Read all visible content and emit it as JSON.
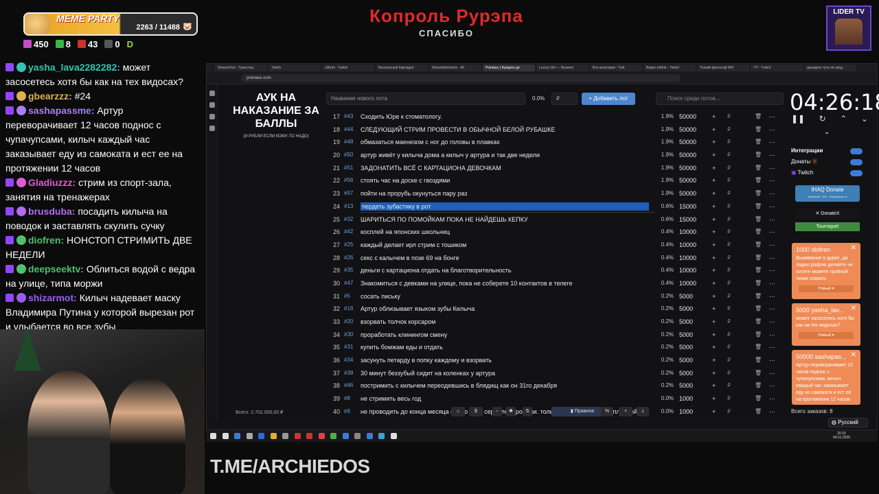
{
  "overlay": {
    "alert_title": "Копроль Рурэпа",
    "alert_sub": "СПАСИБО",
    "meme_party_label": "MEME PARTY",
    "meme_progress": "2263 / 11488",
    "stats": {
      "points": "450",
      "k": "8",
      "ua": "43",
      "w": "0"
    },
    "lider_label": "LIDER TV",
    "tme": "T.ME/ARCHIEDOS"
  },
  "chat": [
    {
      "user": "yasha_lava2282282:",
      "text": "может засосетесь хотя бы как на тех видосах?",
      "color": "#34c3b0"
    },
    {
      "user": "gbearzzz:",
      "text": "#24",
      "color": "#e0b050"
    },
    {
      "user": "sashapassme:",
      "text": "Артур переворачивает 12 часов поднос с чупачупсами, килыч каждый час заказывает еду из самоката и ест ее на протяжении 12 часов",
      "color": "#a77ff0"
    },
    {
      "user": "Gladiuzzz:",
      "text": "стрим из спорт-зала, занятия на тренажерах",
      "color": "#e05bd6"
    },
    {
      "user": "brusduba:",
      "text": "посадить килыча на поводок и заставлять скулить сучку",
      "color": "#b26cf0"
    },
    {
      "user": "diofren:",
      "text": "НОНСТОП СТРИМИТЬ ДВЕ НЕДЕЛИ",
      "color": "#4ec06b"
    },
    {
      "user": "deepseektv:",
      "text": "Облиться водой с ведра на улице, типа моржи",
      "color": "#4ec06b"
    },
    {
      "user": "shizarmot:",
      "text": "Килыч надевает маску Владимира Путина у которой вырезан рот и улыбается во все зубы",
      "color": "#9a5cf0"
    }
  ],
  "browser": {
    "tabs": [
      "StreamVivo - Трансляц",
      "Twitch",
      "s3briel - Twitch",
      "Бесплатный Картадон",
      "StreamElements - 40",
      "Pointauc | Аукцион до",
      "Luxury Girl — Buseeni",
      "Все категории - Twit",
      "Видео toMuk - Twitch",
      "Тонкий философ WH",
      "!!!? - Twitch",
      "аркадиос чуть не увод"
    ],
    "url": "pointauc.com"
  },
  "app": {
    "title": "АУК НА НАКАЗАНИЕ ЗА БАЛЛЫ",
    "subtitle": "(И РУБЛИ ЕСЛИ КОМУ-ТО НАДО)",
    "lot_placeholder": "Название нового лота",
    "lot_pct": "0.0%",
    "lot_currency": "₽",
    "add_button": "Добавить лот",
    "search_placeholder": "Поиск среди лотов...",
    "rows": [
      {
        "n": "17",
        "id": "43",
        "text": "Сходить Юре к стоматологу.",
        "pct": "1.9%",
        "amount": "50000"
      },
      {
        "n": "18",
        "id": "44",
        "text": "СЛЕДУЮЩИЙ СТРИМ ПРОВЕСТИ В ОБЫЧНОЙ БЕЛОЙ РУБАШКЕ",
        "pct": "1.9%",
        "amount": "50000"
      },
      {
        "n": "19",
        "id": "48",
        "text": "обмазаться маенезом с ног до головы в плавках",
        "pct": "1.9%",
        "amount": "50000"
      },
      {
        "n": "20",
        "id": "50",
        "text": "артур живёт у килыча дома а килыч у артура и так две недели",
        "pct": "1.9%",
        "amount": "50000"
      },
      {
        "n": "21",
        "id": "51",
        "text": "ЗАДОНАТИТЬ ВСЁ С КАРТАЦИОНА ДЕВОЧКАМ",
        "pct": "1.9%",
        "amount": "50000"
      },
      {
        "n": "22",
        "id": "56",
        "text": "стоять час на доске с гвоздями",
        "pct": "1.9%",
        "amount": "50000"
      },
      {
        "n": "23",
        "id": "57",
        "text": "пойти на прорубь окунуться пару раз",
        "pct": "1.9%",
        "amount": "50000"
      },
      {
        "n": "24",
        "id": "13",
        "text": "пердеть зубастику в рот",
        "pct": "0.6%",
        "amount": "15000"
      },
      {
        "n": "25",
        "id": "32",
        "text": "ШАРИТЬСЯ ПО ПОМОЙКАМ ПОКА НЕ НАЙДЕШЬ КЕПКУ",
        "pct": "0.6%",
        "amount": "15000"
      },
      {
        "n": "26",
        "id": "42",
        "text": "косплей на японских школьниц",
        "pct": "0.4%",
        "amount": "10000"
      },
      {
        "n": "27",
        "id": "25",
        "text": "каждый делает ирл стрим с тошиком",
        "pct": "0.4%",
        "amount": "10000"
      },
      {
        "n": "28",
        "id": "26",
        "text": "секс с калычем в позе 69 на бонге",
        "pct": "0.4%",
        "amount": "10000"
      },
      {
        "n": "29",
        "id": "35",
        "text": "деньги с картациона отдать на благотворительность",
        "pct": "0.4%",
        "amount": "10000"
      },
      {
        "n": "30",
        "id": "47",
        "text": "Знакомиться с девками на улице, пока не соберете 10 контактов в телеге",
        "pct": "0.4%",
        "amount": "10000"
      },
      {
        "n": "31",
        "id": "5",
        "text": "сосать письку",
        "pct": "0.2%",
        "amount": "5000"
      },
      {
        "n": "32",
        "id": "16",
        "text": "Артур облизывает языком зубы Килыча",
        "pct": "0.2%",
        "amount": "5000"
      },
      {
        "n": "33",
        "id": "20",
        "text": "взорвать толчок корсаром",
        "pct": "0.2%",
        "amount": "5000"
      },
      {
        "n": "34",
        "id": "30",
        "text": "проработать клинингом смену",
        "pct": "0.2%",
        "amount": "5000"
      },
      {
        "n": "35",
        "id": "31",
        "text": "купить бомжам еды и отдать",
        "pct": "0.2%",
        "amount": "5000"
      },
      {
        "n": "36",
        "id": "34",
        "text": "засунуть петарду в попку каждому и взорвать",
        "pct": "0.2%",
        "amount": "5000"
      },
      {
        "n": "37",
        "id": "38",
        "text": "30 минут беззубый сидит на коленках у артура",
        "pct": "0.2%",
        "amount": "5000"
      },
      {
        "n": "38",
        "id": "46",
        "text": "постримить с килычем переодевшись в блядищ как он 31го декабря",
        "pct": "0.2%",
        "amount": "5000"
      },
      {
        "n": "39",
        "id": "8",
        "text": "не стримить весь год",
        "pct": "0.0%",
        "amount": "1000"
      },
      {
        "n": "40",
        "id": "9",
        "text": "не проводить до конца месяца видео кино сериало игро ауки. только качественный бесплатный кон",
        "pct": "0.0%",
        "amount": "1000"
      }
    ],
    "total": "Всего: 2.702.000,00 ₽",
    "toolbar_rules": "Правила"
  },
  "right": {
    "timer": "04:26:18",
    "integrations_label": "Интеграции",
    "donations_label": "Донаты",
    "twitch_label": "Twitch",
    "ihaq_label": "IHAQ Donate",
    "ihaq_sub": "Комиссия - 5% . Уникальные м",
    "donatex_label": "DonateX",
    "tourniquet_label": "Tourniquet",
    "cards": [
      {
        "head": "1000 diofren",
        "body": "Выживание в дурке, да ладно рофлю делайте че хотите можете тройной чизик схавать",
        "btn": "Новый"
      },
      {
        "head": "5000 yasha_lav...",
        "body": "может засосетесь хотя бы как на тех видосах?",
        "btn": "Новый"
      },
      {
        "head": "50000 sashapas...",
        "body": "Артур переворачивает 12 часов поднос с чупачупсами, килыч каждый час заказывает еду из самоката и ест ее на протяжении 12 часов",
        "btn": ""
      }
    ],
    "orders_label": "Всего заказов:",
    "orders_count": "8",
    "language": "Русский"
  },
  "taskbar": {
    "time": "20:16",
    "date": "09.01.2026"
  }
}
